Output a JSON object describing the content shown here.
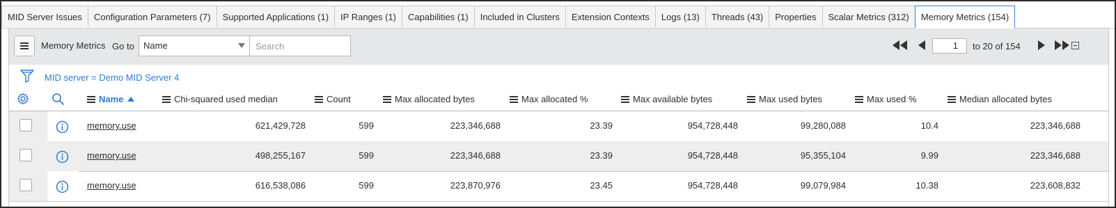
{
  "tabs": [
    {
      "label": "MID Server Issues"
    },
    {
      "label": "Configuration Parameters (7)"
    },
    {
      "label": "Supported Applications (1)"
    },
    {
      "label": "IP Ranges (1)"
    },
    {
      "label": "Capabilities (1)"
    },
    {
      "label": "Included in Clusters"
    },
    {
      "label": "Extension Contexts"
    },
    {
      "label": "Logs (13)"
    },
    {
      "label": "Threads (43)"
    },
    {
      "label": "Properties"
    },
    {
      "label": "Scalar Metrics (312)"
    },
    {
      "label": "Memory Metrics (154)"
    }
  ],
  "active_tab": "Memory Metrics (154)",
  "toolbar": {
    "title": "Memory Metrics",
    "goto_label": "Go to",
    "goto_selected": "Name",
    "search_placeholder": "Search",
    "page_value": "1",
    "page_range": "to 20 of 154"
  },
  "filter": {
    "text": "MID server = Demo MID Server 4"
  },
  "columns": [
    {
      "label": "Name",
      "sorted": "asc"
    },
    {
      "label": "Chi-squared used median"
    },
    {
      "label": "Count"
    },
    {
      "label": "Max allocated bytes"
    },
    {
      "label": "Max allocated %"
    },
    {
      "label": "Max available bytes"
    },
    {
      "label": "Max used bytes"
    },
    {
      "label": "Max used %"
    },
    {
      "label": "Median allocated bytes"
    }
  ],
  "rows": [
    {
      "name": "memory.use",
      "chi_squared_used_median": "621,429,728",
      "count": "599",
      "max_allocated_bytes": "223,346,688",
      "max_allocated_pct": "23.39",
      "max_available_bytes": "954,728,448",
      "max_used_bytes": "99,280,088",
      "max_used_pct": "10.4",
      "median_allocated_bytes": "223,346,688"
    },
    {
      "name": "memory.use",
      "chi_squared_used_median": "498,255,167",
      "count": "599",
      "max_allocated_bytes": "223,346,688",
      "max_allocated_pct": "23.39",
      "max_available_bytes": "954,728,448",
      "max_used_bytes": "95,355,104",
      "max_used_pct": "9.99",
      "median_allocated_bytes": "223,346,688"
    },
    {
      "name": "memory.use",
      "chi_squared_used_median": "616,538,086",
      "count": "599",
      "max_allocated_bytes": "223,870,976",
      "max_allocated_pct": "23.45",
      "max_available_bytes": "954,728,448",
      "max_used_bytes": "99,079,984",
      "max_used_pct": "10.38",
      "median_allocated_bytes": "223,608,832"
    }
  ],
  "colors": {
    "accent": "#2f7ad6",
    "toolbar_bg": "#e6e7e8",
    "row_alt_bg": "#eeeeee"
  },
  "icons": [
    "hamburger-icon",
    "first-page-icon",
    "previous-page-icon",
    "next-page-icon",
    "last-page-icon",
    "collapse-icon",
    "filter-funnel-icon",
    "gear-icon",
    "search-icon",
    "info-icon"
  ]
}
